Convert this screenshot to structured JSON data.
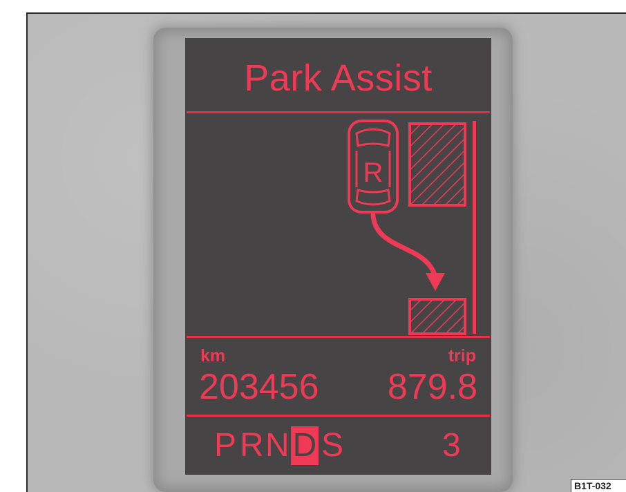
{
  "display": {
    "title": "Park Assist",
    "odometer_label": "km",
    "odometer_value": "203456",
    "trip_label": "trip",
    "trip_value": "879.8",
    "gear_letters": [
      "P",
      "R",
      "N",
      "D",
      "S"
    ],
    "active_gear": "D",
    "gear_number": "3",
    "reverse_badge": "R"
  },
  "figure_code": "B1T-032",
  "colors": {
    "accent": "#ef3a55",
    "screen": "#464444",
    "frame": "#b9b9b9"
  },
  "icons": [
    "car-reversing-icon",
    "parked-vehicle-icon",
    "reverse-path-arrow-icon",
    "curb-line-icon"
  ]
}
